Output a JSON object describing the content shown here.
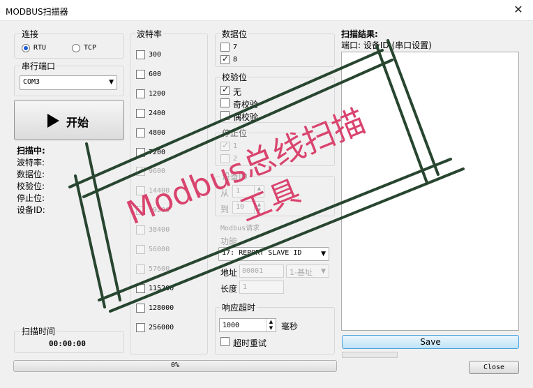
{
  "window": {
    "title": "MODBUS扫描器"
  },
  "connection": {
    "title": "连接",
    "rtu_label": "RTU",
    "tcp_label": "TCP",
    "selected": "RTU"
  },
  "serial_port": {
    "title": "串行端口",
    "value": "COM3"
  },
  "start_button": {
    "label": "开始"
  },
  "status": {
    "scanning": "扫描中:",
    "baud": "波特率:",
    "data_bits": "数据位:",
    "parity": "校验位:",
    "stop_bits": "停止位:",
    "device_id": "设备ID:"
  },
  "scan_time": {
    "title": "扫描时间",
    "value": "00:00:00"
  },
  "baud_rates": {
    "title": "波特率",
    "items": [
      {
        "label": "300",
        "checked": false,
        "enabled": true
      },
      {
        "label": "600",
        "checked": false,
        "enabled": true
      },
      {
        "label": "1200",
        "checked": false,
        "enabled": true
      },
      {
        "label": "2400",
        "checked": false,
        "enabled": true
      },
      {
        "label": "4800",
        "checked": false,
        "enabled": true
      },
      {
        "label": "7200",
        "checked": false,
        "enabled": true
      },
      {
        "label": "9600",
        "checked": true,
        "enabled": false
      },
      {
        "label": "14400",
        "checked": false,
        "enabled": false
      },
      {
        "label": "19200",
        "checked": false,
        "enabled": false
      },
      {
        "label": "38400",
        "checked": false,
        "enabled": false
      },
      {
        "label": "56000",
        "checked": false,
        "enabled": false
      },
      {
        "label": "57600",
        "checked": false,
        "enabled": false
      },
      {
        "label": "115200",
        "checked": false,
        "enabled": true
      },
      {
        "label": "128000",
        "checked": false,
        "enabled": true
      },
      {
        "label": "256000",
        "checked": false,
        "enabled": true
      }
    ]
  },
  "data_bits": {
    "title": "数据位",
    "items": [
      {
        "label": "7",
        "checked": false
      },
      {
        "label": "8",
        "checked": true
      }
    ]
  },
  "parity": {
    "title": "校验位",
    "items": [
      {
        "label": "无",
        "checked": true
      },
      {
        "label": "奇校验",
        "checked": false
      },
      {
        "label": "偶校验",
        "checked": false
      }
    ]
  },
  "stop_bits": {
    "title": "停止位",
    "items": [
      {
        "label": "1",
        "checked": true
      },
      {
        "label": "2",
        "checked": false
      }
    ]
  },
  "device_address": {
    "title": "设备ID",
    "from_label": "从",
    "from_value": "1",
    "to_label": "到",
    "to_value": "10"
  },
  "modbus_request": {
    "title": "Modbus请求",
    "function_label": "功能",
    "function_value": "17: REPORT SLAVE ID",
    "address_label": "地址",
    "address_value": "00001",
    "address_base": "1-基址",
    "length_label": "长度",
    "length_value": "1"
  },
  "timeout": {
    "title": "响应超时",
    "value": "1000",
    "unit": "毫秒",
    "retry_label": "超时重试",
    "retry_checked": false
  },
  "results": {
    "title": "扫描结果:",
    "subtitle": "端口: 设备ID (串口设置)",
    "button_label": "Save"
  },
  "progress": {
    "value": 0,
    "label": "0%"
  },
  "close_button": {
    "label": "Close"
  },
  "watermark": {
    "line1": "Modbus总线扫描",
    "line2": "工具",
    "color": "#d9446e",
    "frame_color": "#27452f"
  }
}
